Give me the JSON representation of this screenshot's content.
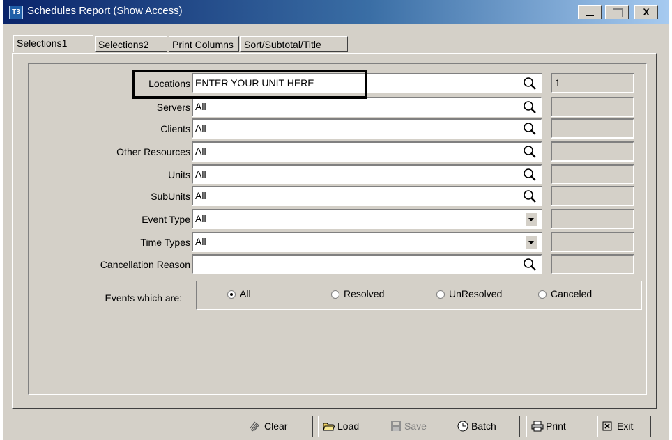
{
  "window": {
    "title": "Schedules Report (Show Access)",
    "icon_text": "T3",
    "controls": {
      "minimize": "_",
      "maximize": "□",
      "close": "X"
    }
  },
  "tabs": [
    {
      "label": "Selections1",
      "active": true
    },
    {
      "label": "Selections2",
      "active": false
    },
    {
      "label": "Print Columns",
      "active": false
    },
    {
      "label": "Sort/Subtotal/Title",
      "active": false
    }
  ],
  "fields": [
    {
      "label": "Locations",
      "value": "ENTER YOUR UNIT HERE",
      "control": "lookup",
      "count": "1"
    },
    {
      "label": "Servers",
      "value": "All",
      "control": "lookup",
      "count": ""
    },
    {
      "label": "Clients",
      "value": "All",
      "control": "lookup",
      "count": ""
    },
    {
      "label": "Other Resources",
      "value": "All",
      "control": "lookup",
      "count": ""
    },
    {
      "label": "Units",
      "value": "All",
      "control": "lookup",
      "count": ""
    },
    {
      "label": "SubUnits",
      "value": "All",
      "control": "lookup",
      "count": ""
    },
    {
      "label": "Event Type",
      "value": "All",
      "control": "dropdown",
      "count": ""
    },
    {
      "label": "Time Types",
      "value": "All",
      "control": "dropdown",
      "count": ""
    },
    {
      "label": "Cancellation Reason",
      "value": "",
      "control": "lookup",
      "count": ""
    }
  ],
  "events": {
    "label": "Events which are:",
    "options": [
      {
        "label": "All",
        "selected": true
      },
      {
        "label": "Resolved",
        "selected": false
      },
      {
        "label": "UnResolved",
        "selected": false
      },
      {
        "label": "Canceled",
        "selected": false
      }
    ]
  },
  "buttons": [
    {
      "label": "Clear",
      "icon": "broom-icon",
      "enabled": true
    },
    {
      "label": "Load",
      "icon": "open-folder-icon",
      "enabled": true
    },
    {
      "label": "Save",
      "icon": "floppy-disk-icon",
      "enabled": false
    },
    {
      "label": "Batch",
      "icon": "clock-icon",
      "enabled": true
    },
    {
      "label": "Print",
      "icon": "printer-icon",
      "enabled": true
    },
    {
      "label": "Exit",
      "icon": "exit-icon",
      "enabled": true
    }
  ],
  "colors": {
    "face": "#d4d0c8",
    "title_start": "#0a246a",
    "title_end": "#a6caf0"
  }
}
